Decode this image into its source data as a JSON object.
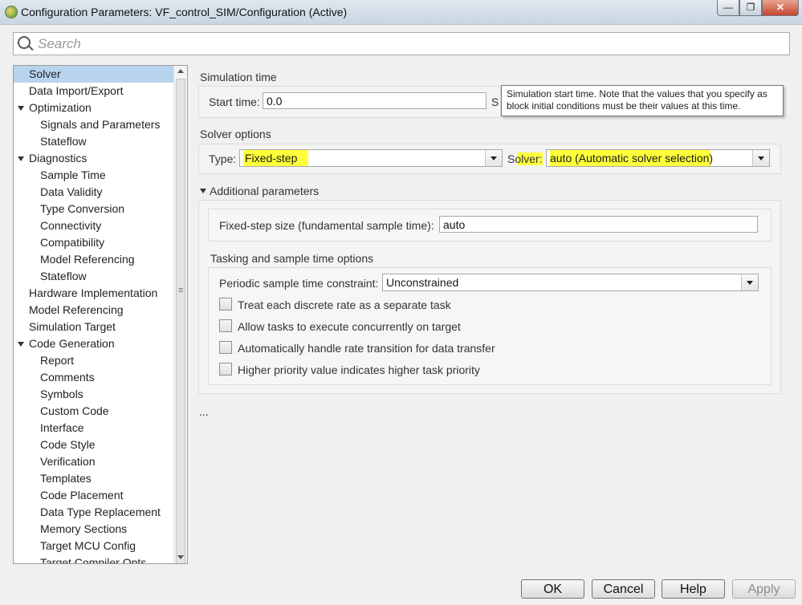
{
  "window": {
    "title": "Configuration Parameters: VF_control_SIM/Configuration (Active)",
    "controls": {
      "minimize": "—",
      "maximize": "❐",
      "close": "✕"
    }
  },
  "search": {
    "placeholder": "Search"
  },
  "tree": {
    "items": [
      {
        "label": "Solver",
        "level": 0,
        "selected": true
      },
      {
        "label": "Data Import/Export",
        "level": 0
      },
      {
        "label": "Optimization",
        "level": 0,
        "expanded": true
      },
      {
        "label": "Signals and Parameters",
        "level": 1
      },
      {
        "label": "Stateflow",
        "level": 1
      },
      {
        "label": "Diagnostics",
        "level": 0,
        "expanded": true
      },
      {
        "label": "Sample Time",
        "level": 1
      },
      {
        "label": "Data Validity",
        "level": 1
      },
      {
        "label": "Type Conversion",
        "level": 1
      },
      {
        "label": "Connectivity",
        "level": 1
      },
      {
        "label": "Compatibility",
        "level": 1
      },
      {
        "label": "Model Referencing",
        "level": 1
      },
      {
        "label": "Stateflow",
        "level": 1
      },
      {
        "label": "Hardware Implementation",
        "level": 0
      },
      {
        "label": "Model Referencing",
        "level": 0
      },
      {
        "label": "Simulation Target",
        "level": 0
      },
      {
        "label": "Code Generation",
        "level": 0,
        "expanded": true
      },
      {
        "label": "Report",
        "level": 1
      },
      {
        "label": "Comments",
        "level": 1
      },
      {
        "label": "Symbols",
        "level": 1
      },
      {
        "label": "Custom Code",
        "level": 1
      },
      {
        "label": "Interface",
        "level": 1
      },
      {
        "label": "Code Style",
        "level": 1
      },
      {
        "label": "Verification",
        "level": 1
      },
      {
        "label": "Templates",
        "level": 1
      },
      {
        "label": "Code Placement",
        "level": 1
      },
      {
        "label": "Data Type Replacement",
        "level": 1
      },
      {
        "label": "Memory Sections",
        "level": 1
      },
      {
        "label": "Target MCU Config",
        "level": 1
      },
      {
        "label": "Target Compiler Opts",
        "level": 1
      }
    ]
  },
  "simulation_time": {
    "heading": "Simulation time",
    "start_label": "Start time:",
    "start_value": "0.0",
    "stop_label_partial": "S"
  },
  "tooltip": {
    "line1": "Simulation start time. Note that the values that you specify as",
    "line2": "block initial conditions must be their values at this time."
  },
  "solver_options": {
    "heading": "Solver options",
    "type_label": "Type:",
    "type_value": "Fixed-step",
    "solver_label": "Solver:",
    "solver_value": "auto (Automatic solver selection)"
  },
  "additional": {
    "heading": "Additional parameters",
    "step_label": "Fixed-step size (fundamental sample time):",
    "step_value": "auto",
    "tasking_heading": "Tasking and sample time options",
    "constraint_label": "Periodic sample time constraint:",
    "constraint_value": "Unconstrained",
    "checkboxes": [
      {
        "label": "Treat each discrete rate as a separate task",
        "checked": false
      },
      {
        "label": "Allow tasks to execute concurrently on target",
        "checked": false
      },
      {
        "label": "Automatically handle rate transition for data transfer",
        "checked": false
      },
      {
        "label": "Higher priority value indicates higher task priority",
        "checked": false
      }
    ]
  },
  "ellipsis": "...",
  "buttons": {
    "ok": "OK",
    "cancel": "Cancel",
    "help": "Help",
    "apply": "Apply"
  },
  "colors": {
    "highlight": "#ffff3b",
    "selection": "#b7d3ee"
  }
}
